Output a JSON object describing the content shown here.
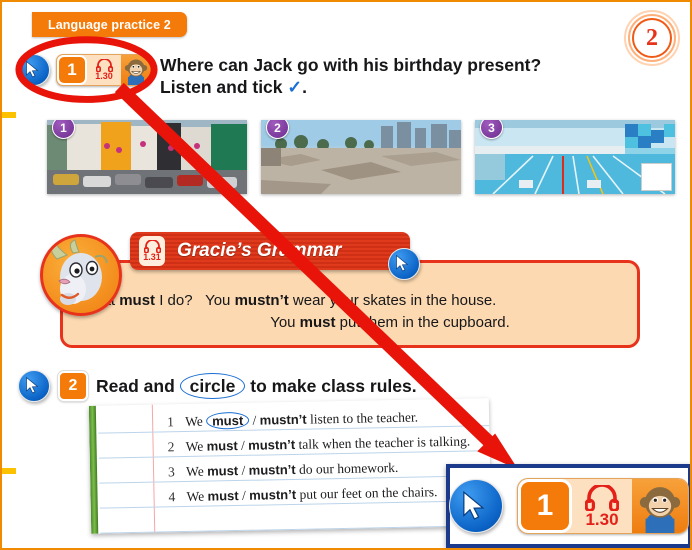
{
  "page": {
    "banner_label": "Language practice 2",
    "page_number": "2",
    "accent_orange": "#f47b0a",
    "accent_red": "#e8331c",
    "annotation_red": "#e8140a",
    "callout_border_blue": "#1b3a8c"
  },
  "exercise1": {
    "number": "1",
    "audio_track": "1.30",
    "heading_line1": "Where can Jack go with his birthday present?",
    "heading_line2": "Listen and tick",
    "tick_glyph": "✓",
    "heading_line2_end": ".",
    "cursor_icon": "cursor-arrow-icon",
    "headphones_icon": "headphones-icon",
    "character_icon": "monkey-character-icon"
  },
  "photos": [
    {
      "badge": "1",
      "alt": "busy town street with cars and shops",
      "has_tickbox": false
    },
    {
      "badge": "2",
      "alt": "skate park with ramps and city skyline",
      "has_tickbox": false
    },
    {
      "badge": "3",
      "alt": "indoor swimming pool with lanes",
      "has_tickbox": true
    }
  ],
  "grammar": {
    "title": "Gracie’s Grammar",
    "audio_track": "1.31",
    "mascot_icon": "goat-mascot-icon",
    "cursor_icon": "cursor-arrow-icon",
    "line1_a": "What ",
    "line1_must": "must",
    "line1_b": " I do?",
    "line1_c": "You ",
    "line1_mustnt": "mustn’t",
    "line1_d": " wear your skates in the house.",
    "line2_a": "You ",
    "line2_must": "must",
    "line2_b": " put them in the cupboard."
  },
  "exercise2": {
    "number": "2",
    "heading_a": "Read and ",
    "heading_circled": "circle",
    "heading_b": " to make class rules.",
    "cursor_icon": "cursor-arrow-icon"
  },
  "notebook": {
    "items": [
      {
        "n": "1",
        "a": "We ",
        "must": "must",
        "sep": " / ",
        "mustnt": "mustn’t",
        "b": " listen to the teacher.",
        "circled": "must"
      },
      {
        "n": "2",
        "a": "We ",
        "must": "must",
        "sep": " / ",
        "mustnt": "mustn’t",
        "b": " talk when the teacher is talking.",
        "circled": ""
      },
      {
        "n": "3",
        "a": "We ",
        "must": "must",
        "sep": " / ",
        "mustnt": "mustn’t",
        "b": " do our homework.",
        "circled": ""
      },
      {
        "n": "4",
        "a": "We ",
        "must": "must",
        "sep": " / ",
        "mustnt": "mustn’t",
        "b": " put our feet on the chairs.",
        "circled": ""
      }
    ]
  },
  "callout": {
    "number": "1",
    "audio_track": "1.30",
    "cursor_icon": "cursor-arrow-icon",
    "headphones_icon": "headphones-icon",
    "character_icon": "monkey-character-icon"
  }
}
